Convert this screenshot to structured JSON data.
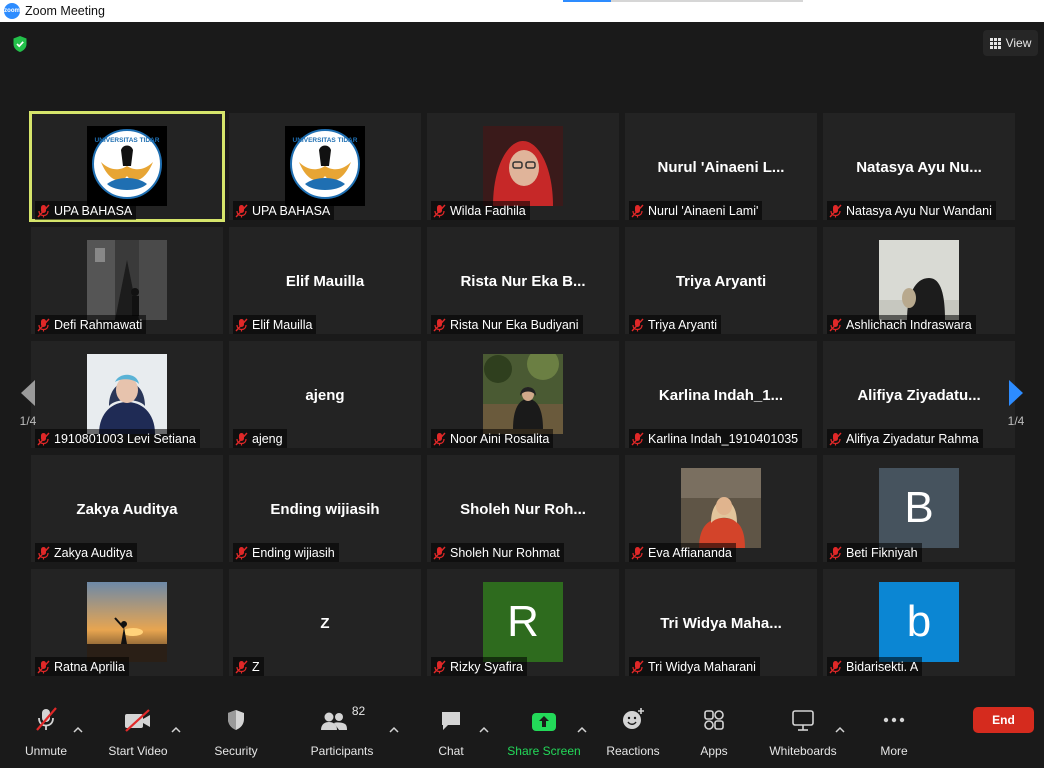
{
  "window": {
    "title": "Zoom Meeting"
  },
  "view_button": {
    "label": "View"
  },
  "colors": {
    "accent": "#2d8cff",
    "speaker_border": "#d6e56b",
    "muted": "#e02828",
    "end": "#d52b1e",
    "share": "#23d959"
  },
  "nav": {
    "left_page": "1/4",
    "right_page": "1/4"
  },
  "tiles": [
    {
      "display": "logo",
      "name": "UPA BAHASA",
      "active": true,
      "logo_text": "UNIVERSITAS TIDAR"
    },
    {
      "display": "logo",
      "name": "UPA BAHASA",
      "logo_text": "UNIVERSITAS TIDAR"
    },
    {
      "display": "photo",
      "name": "Wilda Fadhila",
      "photo": "wilda-photo"
    },
    {
      "display": "text",
      "name": "Nurul 'Ainaeni Lami'",
      "center": "Nurul  'Ainaeni  L..."
    },
    {
      "display": "text",
      "name": "Natasya Ayu Nur Wandani",
      "center": "Natasya  Ayu  Nu..."
    },
    {
      "display": "photo",
      "name": "Defi Rahmawati",
      "photo": "defi-photo"
    },
    {
      "display": "text",
      "name": "Elif Mauilla",
      "center": "Elif Mauilla"
    },
    {
      "display": "text",
      "name": "Rista Nur Eka Budiyani",
      "center": "Rista Nur Eka B..."
    },
    {
      "display": "text",
      "name": "Triya Aryanti",
      "center": "Triya Aryanti"
    },
    {
      "display": "photo",
      "name": "Ashlichach Indraswara",
      "photo": "ashlichach-photo"
    },
    {
      "display": "photo",
      "name": "1910801003 Levi Setiana",
      "photo": "levi-photo"
    },
    {
      "display": "text",
      "name": "ajeng",
      "center": "ajeng"
    },
    {
      "display": "photo",
      "name": "Noor Aini Rosalita",
      "photo": "noor-photo"
    },
    {
      "display": "text",
      "name": "Karlina Indah_1910401035",
      "center": "Karlina  Indah_1..."
    },
    {
      "display": "text",
      "name": "Alifiya Ziyadatur Rahma",
      "center": "Alifiya  Ziyadatu..."
    },
    {
      "display": "text",
      "name": "Zakya Auditya",
      "center": "Zakya Auditya"
    },
    {
      "display": "text",
      "name": "Ending wijiasih",
      "center": "Ending wijiasih"
    },
    {
      "display": "text",
      "name": "Sholeh Nur Rohmat",
      "center": "Sholeh  Nur  Roh..."
    },
    {
      "display": "photo",
      "name": "Eva Affiananda",
      "photo": "eva-photo"
    },
    {
      "display": "letter",
      "name": "Beti Fikniyah",
      "letter": "B",
      "color": "#46535e"
    },
    {
      "display": "photo",
      "name": "Ratna Aprilia",
      "photo": "ratna-photo"
    },
    {
      "display": "text",
      "name": "Z",
      "center": "Z"
    },
    {
      "display": "letter",
      "name": "Rizky Syafira",
      "letter": "R",
      "color": "#2e6b1e"
    },
    {
      "display": "text",
      "name": "Tri Widya Maharani",
      "center": "Tri  Widya  Maha..."
    },
    {
      "display": "letter",
      "name": "Bidarisekti. A",
      "letter": "b",
      "color": "#0b86d3"
    }
  ],
  "toolbar": {
    "unmute": "Unmute",
    "start_video": "Start Video",
    "security": "Security",
    "participants": "Participants",
    "participants_count": "82",
    "chat": "Chat",
    "share_screen": "Share Screen",
    "reactions": "Reactions",
    "apps": "Apps",
    "whiteboards": "Whiteboards",
    "more": "More",
    "end": "End"
  }
}
